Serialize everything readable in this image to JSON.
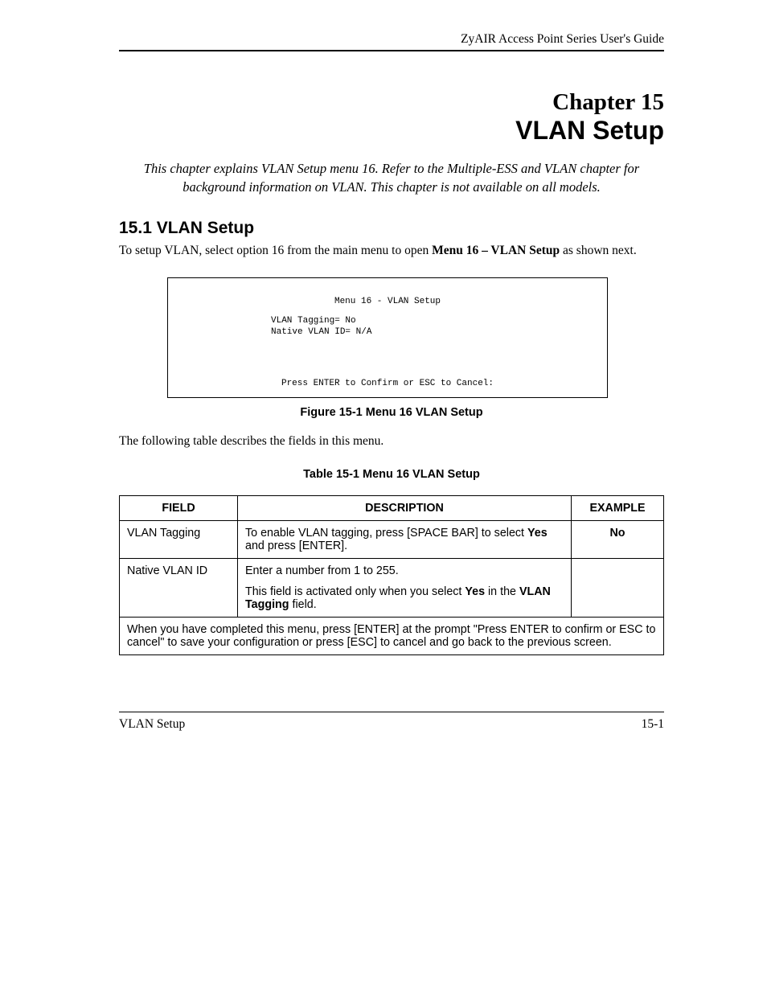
{
  "header": {
    "guide_title": "ZyAIR Access Point Series User's Guide"
  },
  "chapter": {
    "label": "Chapter 15",
    "title": "VLAN Setup",
    "intro": "This chapter explains VLAN Setup menu 16. Refer to the Multiple-ESS and VLAN chapter for background information on VLAN. This chapter is not available on all models."
  },
  "section": {
    "heading": "15.1  VLAN Setup",
    "para_pre": "To setup VLAN, select option 16 from the main menu to open ",
    "para_bold": "Menu 16 – VLAN Setup",
    "para_post": " as shown next."
  },
  "terminal": {
    "title": "Menu 16 - VLAN Setup",
    "line1": "VLAN Tagging= No",
    "line2": "Native VLAN ID= N/A",
    "footer": "Press ENTER to Confirm or ESC to Cancel:"
  },
  "figure_caption": "Figure 15-1 Menu 16 VLAN Setup",
  "table_intro": "The following table describes the fields in this menu.",
  "table_caption": "Table 15-1 Menu 16 VLAN Setup",
  "table": {
    "headers": {
      "field": "FIELD",
      "description": "DESCRIPTION",
      "example": "EXAMPLE"
    },
    "rows": [
      {
        "field": "VLAN Tagging",
        "desc_pre": "To enable VLAN tagging, press [SPACE BAR] to select ",
        "desc_bold": "Yes",
        "desc_post": " and press [ENTER].",
        "example": "No"
      },
      {
        "field": "Native VLAN ID",
        "desc1": "Enter a number from 1 to 255.",
        "desc2_pre": "This field is activated only when you select ",
        "desc2_bold1": "Yes",
        "desc2_mid": " in the ",
        "desc2_bold2": "VLAN Tagging",
        "desc2_post": " field.",
        "example": ""
      }
    ],
    "footer_note": "When you have completed this menu, press [ENTER] at the prompt \"Press ENTER to confirm or ESC to cancel\" to save your configuration or press [ESC] to cancel and go back to the previous screen."
  },
  "footer": {
    "left": "VLAN Setup",
    "right": "15-1"
  }
}
